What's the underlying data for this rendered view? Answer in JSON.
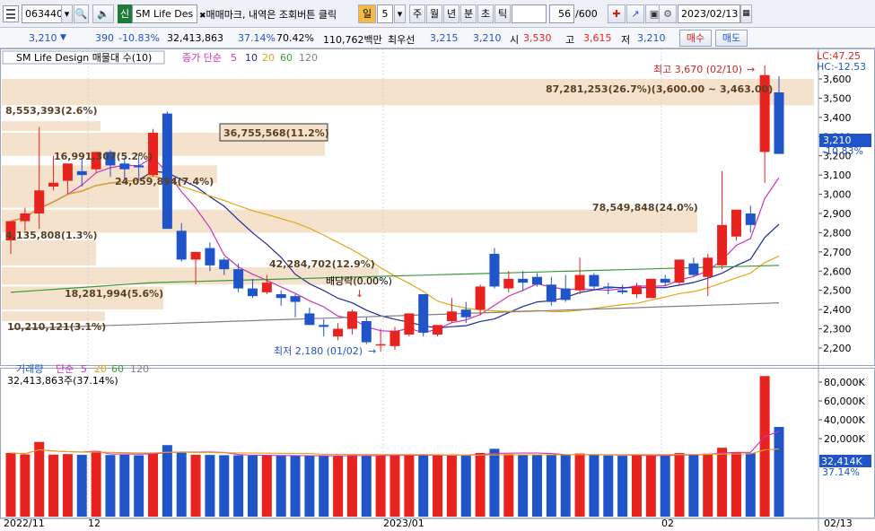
{
  "toolbar": {
    "code": "063440",
    "sin_label": "신",
    "stock_name": "SM Life Des",
    "notice": "매매마크, 내역은 조회버튼 클릭",
    "period_label": "일",
    "period_value": "5",
    "periods": [
      "주",
      "월",
      "년",
      "분",
      "초",
      "틱"
    ],
    "count": "56",
    "count_max": "/600",
    "date": "2023/02/13"
  },
  "quote": {
    "price": "3,210",
    "change": "390",
    "change_pct": "-10.83%",
    "volume": "32,413,863",
    "vol_pct": "37.14%",
    "ratio": "70.42%",
    "amount": "110,762백만",
    "best_label": "최우선",
    "ask": "3,215",
    "bid": "3,210",
    "open_label": "시",
    "open": "3,530",
    "high_label": "고",
    "high": "3,615",
    "low_label": "저",
    "low": "3,210",
    "buy_label": "매수",
    "sell_label": "매도"
  },
  "price_panel": {
    "title": "SM Life Design 매물대 수(10)",
    "ma_title": "종가 단순",
    "ma_periods": [
      "5",
      "10",
      "20",
      "60",
      "120"
    ],
    "lc": "LC:47.25",
    "hc": "HC:-12.53",
    "high_note": "최고 3,670 (02/10)",
    "low_note": "최저 2,180 (01/02)",
    "dividend_note": "배당락(0.00%)",
    "current_price": "3,210",
    "current_pct": "-10.83%",
    "y_ticks": [
      "3,600",
      "3,500",
      "3,400",
      "3,300",
      "3,200",
      "3,100",
      "3,000",
      "2,900",
      "2,800",
      "2,700",
      "2,600",
      "2,500",
      "2,400",
      "2,300",
      "2,200"
    ],
    "profile": [
      {
        "from": 3463,
        "to": 3600,
        "label": "87,281,253(26.7%)(3,600.00 ~ 3,463.00)"
      },
      {
        "from": 3200,
        "to": 3320,
        "label": "36,755,568(11.2%)"
      },
      {
        "from": 3060,
        "to": 3150,
        "label": "24,059,894(7.4%)"
      },
      {
        "from": 2930,
        "to": 3060,
        "label": "16,991,307(5.2%)"
      },
      {
        "from": 2800,
        "to": 2920,
        "label": "78,549,848(24.0%)"
      },
      {
        "from": 2630,
        "to": 2760,
        "label": "4,135,808(1.3%)"
      },
      {
        "from": 2530,
        "to": 2620,
        "label": "42,284,702(12.9%)"
      },
      {
        "from": 2400,
        "to": 2520,
        "label": "18,281,994(5.6%)"
      },
      {
        "from": 2340,
        "to": 2390,
        "label": "10,210,121(3.1%)"
      },
      {
        "from": 3330,
        "to": 3380,
        "label": "8,553,393(2.6%)"
      }
    ]
  },
  "volume_panel": {
    "title": "거래량",
    "ma_title": "단순",
    "ma_periods": [
      "5",
      "20",
      "60",
      "120"
    ],
    "current_text": "32,413,863주(37.14%)",
    "current_value": "32,414K",
    "current_pct": "37.14%",
    "y_ticks": [
      "80,000K",
      "60,000K",
      "40,000K",
      "20,000K"
    ]
  },
  "x_labels": [
    "2022/11",
    "12",
    "2023/01",
    "02",
    "02/13"
  ],
  "colors": {
    "up": "#e8221e",
    "down": "#1f55c8",
    "ma5": "#cc33bb",
    "ma10": "#1a2a9c",
    "ma20": "#e6a417",
    "ma60": "#3a9a3a",
    "ma120": "#808080",
    "profile": "#f5e2cc"
  },
  "chart_data": {
    "type": "candlestick",
    "candles": [
      {
        "o": 2760,
        "h": 2830,
        "l": 2690,
        "c": 2860
      },
      {
        "o": 2860,
        "h": 2930,
        "l": 2810,
        "c": 2900
      },
      {
        "o": 2900,
        "h": 3350,
        "l": 2820,
        "c": 3020
      },
      {
        "o": 3040,
        "h": 3200,
        "l": 3020,
        "c": 3060
      },
      {
        "o": 3070,
        "h": 3160,
        "l": 3000,
        "c": 3160
      },
      {
        "o": 3120,
        "h": 3190,
        "l": 3040,
        "c": 3100
      },
      {
        "o": 3130,
        "h": 3220,
        "l": 3110,
        "c": 3220
      },
      {
        "o": 3220,
        "h": 3230,
        "l": 3090,
        "c": 3150
      },
      {
        "o": 3160,
        "h": 3190,
        "l": 3080,
        "c": 3130
      },
      {
        "o": 3150,
        "h": 3210,
        "l": 3080,
        "c": 3140
      },
      {
        "o": 3100,
        "h": 3340,
        "l": 3090,
        "c": 3320
      },
      {
        "o": 3420,
        "h": 3430,
        "l": 2860,
        "c": 2820
      },
      {
        "o": 2810,
        "h": 2850,
        "l": 2650,
        "c": 2660
      },
      {
        "o": 2660,
        "h": 2680,
        "l": 2530,
        "c": 2700
      },
      {
        "o": 2720,
        "h": 2750,
        "l": 2600,
        "c": 2630
      },
      {
        "o": 2660,
        "h": 2670,
        "l": 2580,
        "c": 2610
      },
      {
        "o": 2610,
        "h": 2640,
        "l": 2490,
        "c": 2510
      },
      {
        "o": 2510,
        "h": 2560,
        "l": 2460,
        "c": 2470
      },
      {
        "o": 2490,
        "h": 2580,
        "l": 2480,
        "c": 2540
      },
      {
        "o": 2480,
        "h": 2500,
        "l": 2420,
        "c": 2460
      },
      {
        "o": 2470,
        "h": 2480,
        "l": 2360,
        "c": 2440
      },
      {
        "o": 2380,
        "h": 2410,
        "l": 2320,
        "c": 2320
      },
      {
        "o": 2320,
        "h": 2350,
        "l": 2260,
        "c": 2310
      },
      {
        "o": 2260,
        "h": 2330,
        "l": 2240,
        "c": 2300
      },
      {
        "o": 2300,
        "h": 2400,
        "l": 2270,
        "c": 2390
      },
      {
        "o": 2340,
        "h": 2360,
        "l": 2220,
        "c": 2230
      },
      {
        "o": 2220,
        "h": 2300,
        "l": 2180,
        "c": 2220
      },
      {
        "o": 2210,
        "h": 2310,
        "l": 2190,
        "c": 2290
      },
      {
        "o": 2270,
        "h": 2380,
        "l": 2260,
        "c": 2380
      },
      {
        "o": 2480,
        "h": 2480,
        "l": 2260,
        "c": 2280
      },
      {
        "o": 2270,
        "h": 2290,
        "l": 2260,
        "c": 2320
      },
      {
        "o": 2340,
        "h": 2460,
        "l": 2330,
        "c": 2390
      },
      {
        "o": 2400,
        "h": 2440,
        "l": 2330,
        "c": 2360
      },
      {
        "o": 2400,
        "h": 2530,
        "l": 2370,
        "c": 2520
      },
      {
        "o": 2690,
        "h": 2720,
        "l": 2510,
        "c": 2520
      },
      {
        "o": 2510,
        "h": 2600,
        "l": 2490,
        "c": 2560
      },
      {
        "o": 2560,
        "h": 2600,
        "l": 2500,
        "c": 2540
      },
      {
        "o": 2570,
        "h": 2590,
        "l": 2520,
        "c": 2530
      },
      {
        "o": 2530,
        "h": 2570,
        "l": 2420,
        "c": 2440
      },
      {
        "o": 2510,
        "h": 2580,
        "l": 2440,
        "c": 2450
      },
      {
        "o": 2500,
        "h": 2670,
        "l": 2480,
        "c": 2580
      },
      {
        "o": 2580,
        "h": 2590,
        "l": 2500,
        "c": 2520
      },
      {
        "o": 2520,
        "h": 2540,
        "l": 2480,
        "c": 2510
      },
      {
        "o": 2500,
        "h": 2530,
        "l": 2480,
        "c": 2490
      },
      {
        "o": 2480,
        "h": 2540,
        "l": 2460,
        "c": 2520
      },
      {
        "o": 2460,
        "h": 2550,
        "l": 2460,
        "c": 2560
      },
      {
        "o": 2560,
        "h": 2580,
        "l": 2520,
        "c": 2540
      },
      {
        "o": 2540,
        "h": 2660,
        "l": 2530,
        "c": 2660
      },
      {
        "o": 2640,
        "h": 2670,
        "l": 2570,
        "c": 2580
      },
      {
        "o": 2570,
        "h": 2690,
        "l": 2470,
        "c": 2670
      },
      {
        "o": 2630,
        "h": 3120,
        "l": 2610,
        "c": 2840
      },
      {
        "o": 2780,
        "h": 2900,
        "l": 2760,
        "c": 2920
      },
      {
        "o": 2900,
        "h": 2940,
        "l": 2800,
        "c": 2840
      },
      {
        "o": 3220,
        "h": 3670,
        "l": 3060,
        "c": 3620
      },
      {
        "o": 3530,
        "h": 3615,
        "l": 3210,
        "c": 3210
      }
    ],
    "volume": [
      4800,
      3200,
      16500,
      3000,
      3600,
      2800,
      6900,
      2600,
      2900,
      2300,
      4900,
      13100,
      5700,
      2800,
      2700,
      2400,
      2300,
      1900,
      2100,
      1800,
      1700,
      1900,
      1500,
      1600,
      2600,
      2200,
      1900,
      2800,
      2500,
      3400,
      2000,
      2700,
      2400,
      4800,
      9200,
      3600,
      3100,
      2600,
      2600,
      2800,
      4200,
      2400,
      2000,
      1800,
      2100,
      2400,
      1900,
      4700,
      2800,
      4100,
      10300,
      5400,
      4600,
      86400,
      32414
    ]
  }
}
